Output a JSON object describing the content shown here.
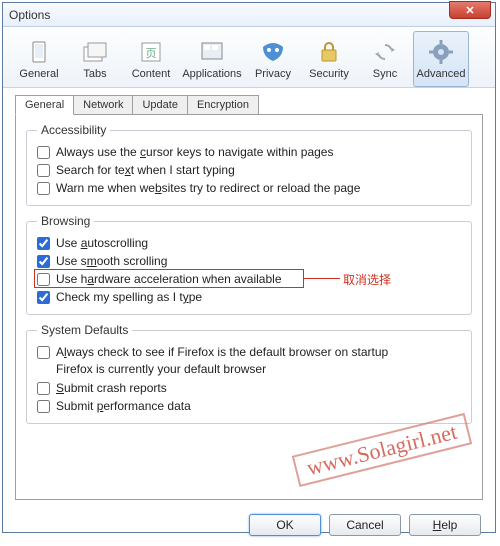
{
  "window": {
    "title": "Options"
  },
  "toolbar": {
    "items": [
      {
        "id": "general",
        "label": "General"
      },
      {
        "id": "tabs",
        "label": "Tabs"
      },
      {
        "id": "content",
        "label": "Content"
      },
      {
        "id": "applications",
        "label": "Applications"
      },
      {
        "id": "privacy",
        "label": "Privacy"
      },
      {
        "id": "security",
        "label": "Security"
      },
      {
        "id": "sync",
        "label": "Sync"
      },
      {
        "id": "advanced",
        "label": "Advanced"
      }
    ]
  },
  "tabs": {
    "items": [
      {
        "label": "General"
      },
      {
        "label": "Network"
      },
      {
        "label": "Update"
      },
      {
        "label": "Encryption"
      }
    ],
    "active": 0
  },
  "accessibility": {
    "legend": "Accessibility",
    "cursor_keys": {
      "label_pre": "Always use the ",
      "label_u": "c",
      "label_post": "ursor keys to navigate within pages",
      "checked": false
    },
    "search_typing": {
      "label_pre": "Search for te",
      "label_u": "x",
      "label_post": "t when I start typing",
      "checked": false
    },
    "warn_redirect": {
      "label_pre": "Warn me when we",
      "label_u": "b",
      "label_post": "sites try to redirect or reload the page",
      "checked": false
    }
  },
  "browsing": {
    "legend": "Browsing",
    "autoscrolling": {
      "label_pre": "Use ",
      "label_u": "a",
      "label_post": "utoscrolling",
      "checked": true
    },
    "smooth": {
      "label_pre": "Use s",
      "label_u": "m",
      "label_post": "ooth scrolling",
      "checked": true
    },
    "hwaccel": {
      "label_pre": "Use h",
      "label_u": "a",
      "label_post": "rdware acceleration when available",
      "checked": false
    },
    "spelling": {
      "label_pre": "Check my spelling as I t",
      "label_u": "y",
      "label_post": "pe",
      "checked": true
    }
  },
  "defaults": {
    "legend": "System Defaults",
    "check_default": {
      "label_pre": "A",
      "label_u": "l",
      "label_post": "ways check to see if Firefox is the default browser on startup",
      "checked": false
    },
    "status_line": "Firefox is currently your default browser",
    "crash": {
      "label_pre": "",
      "label_u": "S",
      "label_post": "ubmit crash reports",
      "checked": false
    },
    "perf": {
      "label_pre": "Submit ",
      "label_u": "p",
      "label_post": "erformance data",
      "checked": false
    }
  },
  "buttons": {
    "ok": "OK",
    "cancel": "Cancel",
    "help_pre": "",
    "help_u": "H",
    "help_post": "elp"
  },
  "annotation": {
    "text": "取消选择"
  },
  "watermark": "www.Solagirl.net"
}
